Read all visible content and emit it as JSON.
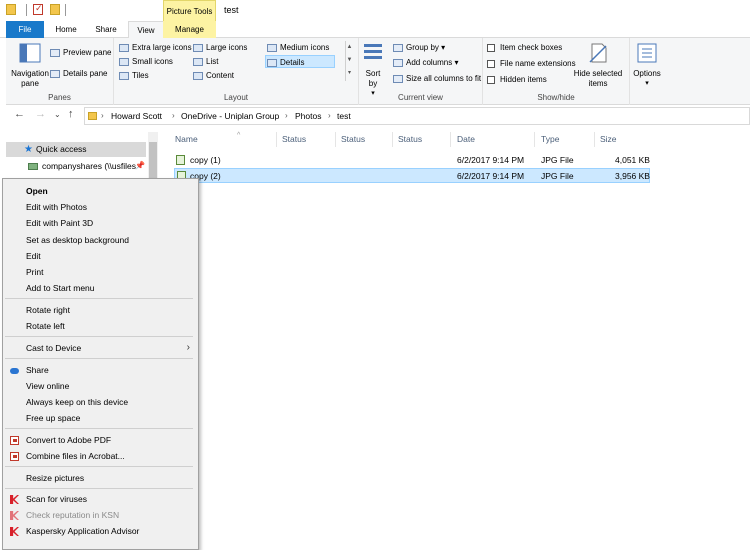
{
  "window": {
    "title": "test",
    "picture_tools": "Picture Tools"
  },
  "tabs": {
    "file": "File",
    "home": "Home",
    "share": "Share",
    "view": "View",
    "manage": "Manage"
  },
  "ribbon": {
    "panes": {
      "label": "Panes",
      "navigation_pane": "Navigation pane",
      "preview_pane": "Preview pane",
      "details_pane": "Details pane"
    },
    "layout": {
      "label": "Layout",
      "items": [
        "Extra large icons",
        "Large icons",
        "Medium icons",
        "Small icons",
        "List",
        "Details",
        "Tiles",
        "Content"
      ],
      "selected": "Details"
    },
    "current_view": {
      "label": "Current view",
      "sort_by": "Sort by",
      "group_by": "Group by",
      "add_columns": "Add columns",
      "size_all_columns": "Size all columns to fit"
    },
    "show_hide": {
      "label": "Show/hide",
      "item_check_boxes": "Item check boxes",
      "file_name_extensions": "File name extensions",
      "hidden_items": "Hidden items",
      "hide_selected": "Hide selected items"
    },
    "options": "Options"
  },
  "address": {
    "breadcrumbs": [
      "Howard Scott",
      "OneDrive - Uniplan Group",
      "Photos",
      "test"
    ]
  },
  "nav_pane": {
    "quick_access": "Quick access",
    "companyshares": "companyshares (\\\\usfiles"
  },
  "columns": [
    "Name",
    "Status",
    "Status",
    "Status",
    "Date",
    "Type",
    "Size"
  ],
  "files": [
    {
      "name": "copy (1)",
      "date": "6/2/2017 9:14 PM",
      "type": "JPG File",
      "size": "4,051 KB",
      "selected": false
    },
    {
      "name": "copy (2)",
      "date": "6/2/2017 9:14 PM",
      "type": "JPG File",
      "size": "3,956 KB",
      "selected": true
    }
  ],
  "context_menu": {
    "open": "Open",
    "edit_with_photos": "Edit with Photos",
    "edit_with_paint3d": "Edit with Paint 3D",
    "set_desktop_bg": "Set as desktop background",
    "edit": "Edit",
    "print": "Print",
    "add_to_start": "Add to Start menu",
    "rotate_right": "Rotate right",
    "rotate_left": "Rotate left",
    "cast_to_device": "Cast to Device",
    "share": "Share",
    "view_online": "View online",
    "always_keep": "Always keep on this device",
    "free_up_space": "Free up space",
    "convert_pdf": "Convert to Adobe PDF",
    "combine_acrobat": "Combine files in Acrobat...",
    "resize_pictures": "Resize pictures",
    "scan_viruses": "Scan for viruses",
    "check_ksn": "Check reputation in KSN",
    "kaspersky_advisor": "Kaspersky Application Advisor"
  },
  "colors": {
    "accent": "#1979ca",
    "selection": "#cce8ff",
    "picture_tools": "#fdf3a3"
  }
}
